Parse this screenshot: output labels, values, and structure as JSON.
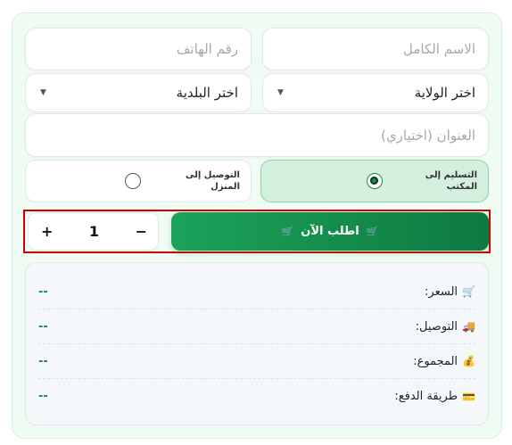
{
  "form": {
    "full_name_placeholder": "الاسم الكامل",
    "phone_placeholder": "رقم الهاتف",
    "state_select": "اختر الولاية",
    "city_select": "اختر البلدية",
    "address_placeholder": "العنوان (اختياري)"
  },
  "delivery": {
    "office_label": "التسليم إلى المكتب",
    "home_label": "التوصيل إلى المنزل",
    "selected": "office"
  },
  "order": {
    "button_label": "اطلب الآن",
    "cart_icon": "🛒",
    "quantity": "1",
    "minus": "−",
    "plus": "+"
  },
  "summary": {
    "rows": [
      {
        "icon": "🛒",
        "label": "السعر:",
        "value": "--"
      },
      {
        "icon": "🚚",
        "label": "التوصيل:",
        "value": "--"
      },
      {
        "icon": "💰",
        "label": "المجموع:",
        "value": "--"
      },
      {
        "icon": "💳",
        "label": "طريقة الدفع:",
        "value": "--"
      }
    ]
  },
  "colors": {
    "accent": "#1e8a4c",
    "highlight_border": "#d00000"
  }
}
